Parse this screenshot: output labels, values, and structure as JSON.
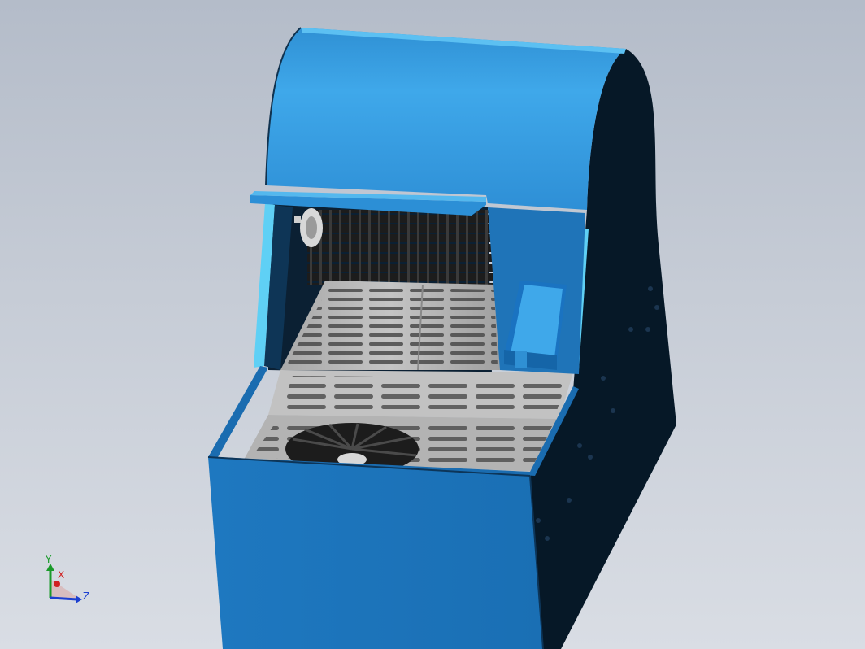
{
  "viewport": {
    "background_top": "#b4bcc9",
    "background_bottom": "#d9dde4"
  },
  "model": {
    "body_color": "#1f7ac4",
    "body_light_color": "#3aa5e8",
    "dark_side_color": "#061827",
    "grate_color": "#b9b9b9",
    "roller_color": "#2a2a2a"
  },
  "triad": {
    "y_label": "Y",
    "x_label": "X",
    "z_label": "Z",
    "y_color": "#1a9a2a",
    "x_color": "#d02020",
    "z_color": "#1c3fd0"
  }
}
